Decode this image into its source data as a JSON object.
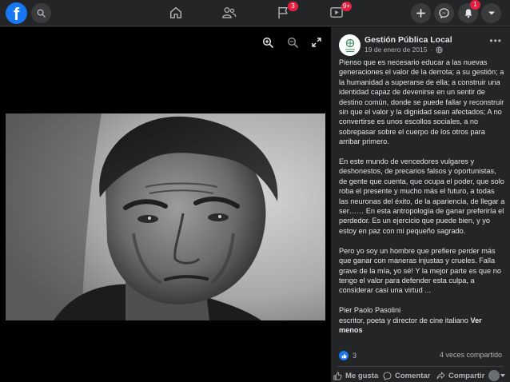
{
  "topbar": {
    "logo": "f",
    "icons": [
      "facebook-logo",
      "search-icon",
      "home-icon",
      "friends-icon",
      "flag-icon",
      "watch-icon",
      "plus-icon",
      "messenger-icon",
      "notifications-icon",
      "chevron-down-icon"
    ],
    "pages_badge": "3",
    "watch_badge": "9+",
    "notifications_badge": "1",
    "accent": "#1877f2",
    "badge_color": "#e41e3f"
  },
  "viewer": {
    "tools": [
      "zoom-in-icon",
      "zoom-out-icon",
      "fullscreen-icon"
    ]
  },
  "post": {
    "page_name": "Gestión Pública Local",
    "date": "19 de enero de 2015",
    "paragraphs": [
      "Pienso que es necesario educar a las nuevas generaciones el valor de la derrota; a su gestión; a la humanidad a superarse de ella; a construir una identidad capaz de devenirse en un sentir de destino común, donde se puede fallar y reconstruir sin que el valor y la dignidad sean afectados; A no convertirse es unos escollos sociales, a no sobrepasar sobre el cuerpo de los otros para arribar primero.",
      "En este mundo de vencedores vulgares y deshonestos, de precarios falsos y oportunistas, de gente que cuenta, que ocupa el poder, que solo roba el presente y mucho más el futuro, a todas las neuronas del éxito, de la apariencia, de llegar a ser…… En esta antropología de ganar preferiría el perdedor. Es un ejercicio que puede bien, y yo estoy en paz con mi pequeño sagrado.",
      "Pero yo soy un hombre que prefiere perder más que ganar con maneras injustas y crueles. Falla grave de la mía, yo sé! Y la mejor parte es que no tengo el valor para defender esta culpa, a considerar casi una virtud ..."
    ],
    "signature_name": "Pier Paolo Pasolini",
    "signature_desc": "escritor, poeta y director de cine italiano",
    "see_more": "Ver menos",
    "reaction_count": "3",
    "shares": "4 veces compartido",
    "actions": {
      "like": "Me gusta",
      "comment": "Comentar",
      "share": "Compartir"
    }
  }
}
